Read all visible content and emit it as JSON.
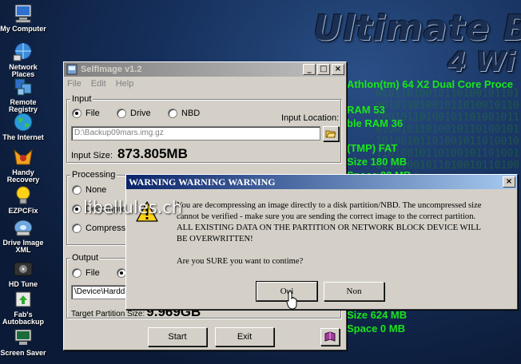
{
  "desktop": {
    "banner_line1": "Ultimate Bo",
    "banner_line2": "4 Wi",
    "binary_noise": "010110100101101001011010010110100101101001011010010110100101101001011010010110100101101001011010010110100101101001011010010110100101101001011010010110100101101001011010",
    "sysinfo": [
      "Athlon(tm) 64 X2 Dual Core Proce",
      "RAM  53",
      "ble RAM  36",
      "(TMP)  FAT",
      "Size  180 MB",
      "Space  80 MB",
      "Size  624 MB",
      "Space  0 MB"
    ],
    "icons": [
      {
        "label": "My Computer",
        "icon": "computer-icon"
      },
      {
        "label": "Network Places",
        "icon": "network-icon"
      },
      {
        "label": "Remote Registry",
        "icon": "registry-icon"
      },
      {
        "label": "The Internet",
        "icon": "globe-icon"
      },
      {
        "label": "Handy Recovery",
        "icon": "recovery-icon"
      },
      {
        "label": "EZPCFix",
        "icon": "lightbulb-icon"
      },
      {
        "label": "Drive Image XML",
        "icon": "drive-icon"
      },
      {
        "label": "HD Tune",
        "icon": "hdtune-icon"
      },
      {
        "label": "Fab's Autobackup",
        "icon": "backup-icon"
      },
      {
        "label": "Screen Saver",
        "icon": "screensaver-icon"
      }
    ]
  },
  "selfimage": {
    "title": "SelfImage v1.2",
    "menu": [
      "File",
      "Edit",
      "Help"
    ],
    "input": {
      "group_label": "Input",
      "options": [
        "File",
        "Drive",
        "NBD"
      ],
      "selected": "File",
      "location_label": "Input Location:",
      "location_value": "D:\\Backup09mars.img.gz",
      "size_label": "Input Size:",
      "size_value": "873.805MB"
    },
    "processing": {
      "group_label": "Processing",
      "options": [
        "None",
        "Decompress",
        "Compress"
      ],
      "selected": "Decompress"
    },
    "output": {
      "group_label": "Output",
      "options": [
        "File"
      ],
      "device_value": "\\Device\\Hardd",
      "target_label": "Target Partition Size:",
      "target_value": "9.969GB"
    },
    "buttons": {
      "start": "Start",
      "exit": "Exit"
    }
  },
  "dialog": {
    "title": "WARNING WARNING WARNING",
    "message_line1": "You are decompressing an image directly to a disk partition/NBD.  The uncompressed size",
    "message_line2": "cannot be verified - make sure you are sending the correct image to the correct partition.",
    "message_line3": "ALL EXISTING DATA ON THE PARTITION OR NETWORK BLOCK DEVICE WILL",
    "message_line4": "BE OVERWRITTEN!",
    "question": "Are you SURE you want to contime?",
    "yes_label": "Oui",
    "no_label": "Non",
    "watermark": "libellules.ch"
  }
}
